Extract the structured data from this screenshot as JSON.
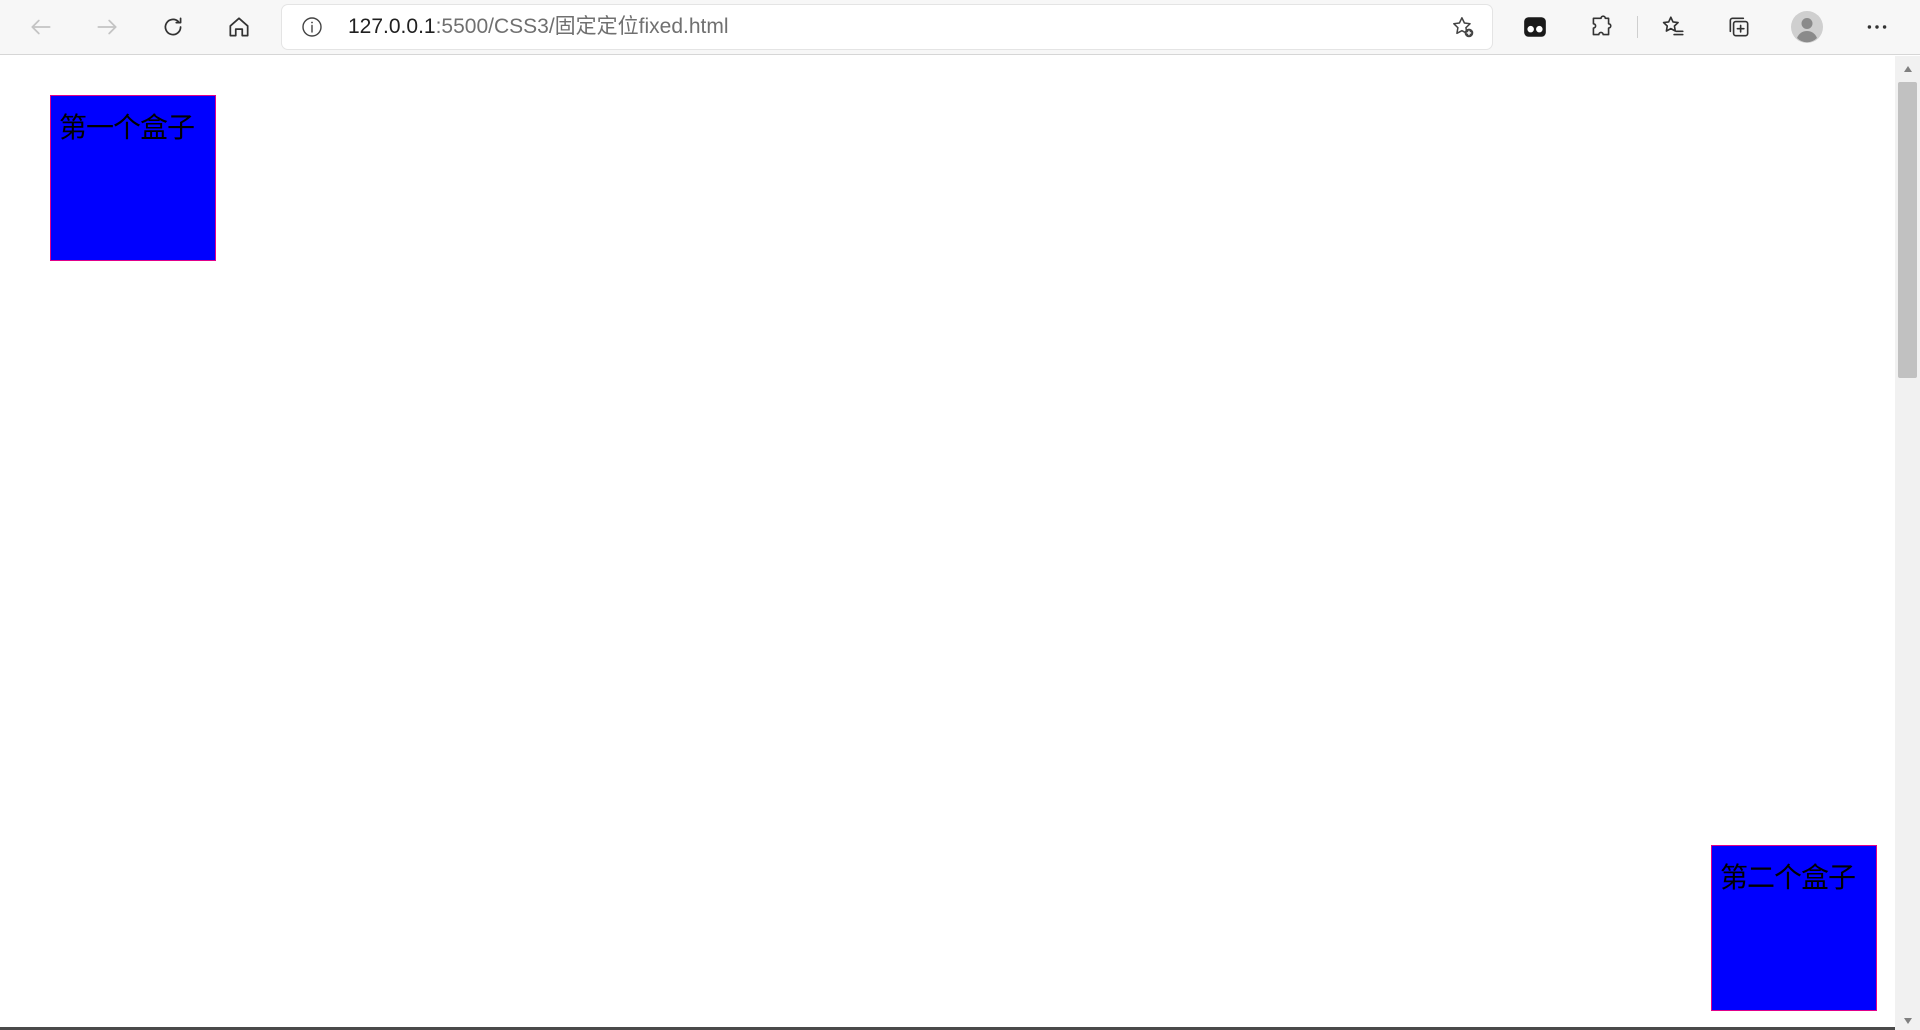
{
  "address_bar": {
    "url_host": "127.0.0.1",
    "url_path": ":5500/CSS3/固定定位fixed.html"
  },
  "page": {
    "boxes": [
      {
        "label": "第一个盒子",
        "fill_color": "#0000ff",
        "border_color": "#e0008a"
      },
      {
        "label": "第二个盒子",
        "fill_color": "#0000ff",
        "border_color": "#e0008a"
      }
    ]
  },
  "icons": {
    "back": "arrow-left-icon",
    "forward": "arrow-right-icon",
    "reload": "refresh-icon",
    "home": "home-icon",
    "site_info": "info-icon",
    "add_favorite": "star-plus-icon",
    "extension": "extension-app-icon",
    "extensions": "puzzle-icon",
    "favorites": "favorites-star-list-icon",
    "collections": "collections-icon",
    "profile": "avatar-icon",
    "more": "ellipsis-icon"
  }
}
